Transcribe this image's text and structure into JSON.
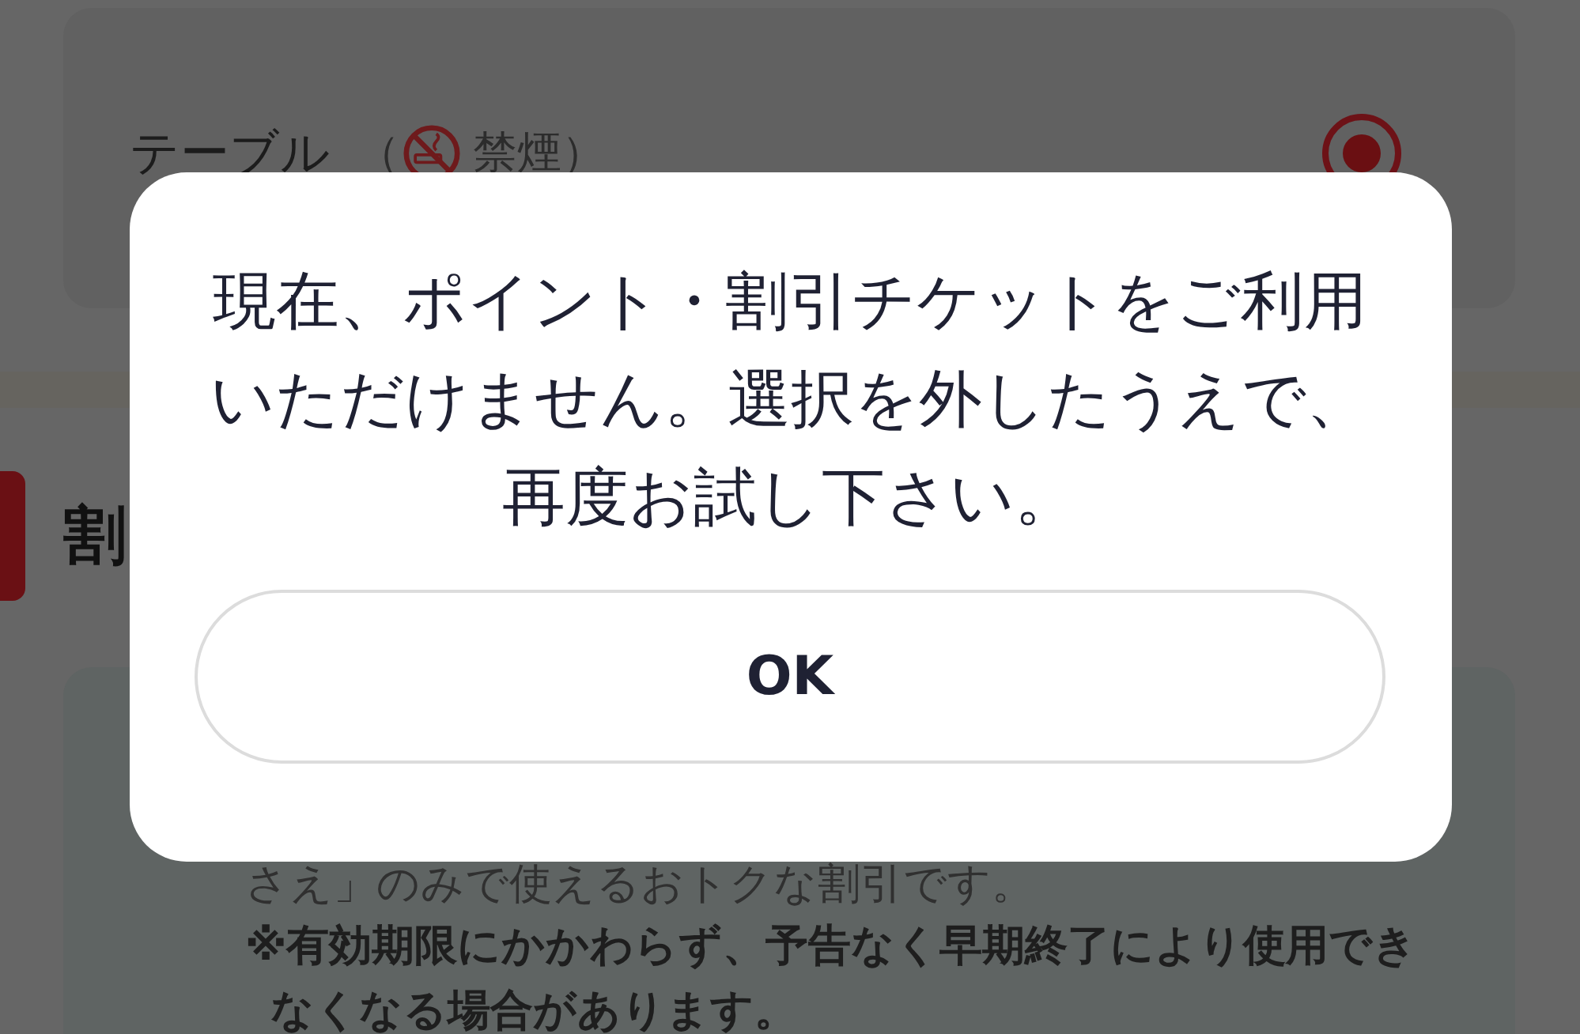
{
  "background_page": {
    "seat_options": [
      {
        "label": "テーブル",
        "note_open": "（",
        "note": "禁煙）",
        "selected": true
      }
    ],
    "section_title": "割",
    "info_card": {
      "text": "さえ」のみで使えるおトクな割引です。",
      "note": "※有効期限にかかわらず、予告なく早期終了により使用できなくなる場合があります。"
    }
  },
  "dialog": {
    "message": "現在、ポイント・割引チケットをご利用いただけません。選択を外したうえで、再度お試し下さい。",
    "buttons": [
      {
        "label": "OK"
      }
    ]
  }
}
